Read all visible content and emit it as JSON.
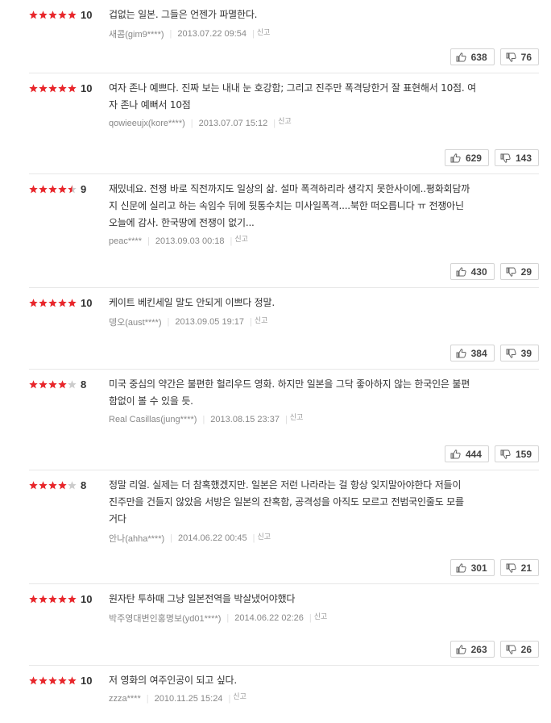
{
  "colors": {
    "star_on": "#e8262b",
    "star_off": "#cccccc",
    "text": "#333333",
    "meta": "#999999"
  },
  "report_label": "신고",
  "reviews": [
    {
      "stars": 5,
      "half": false,
      "score": "10",
      "lines": [
        "겁없는 일본. 그들은 언젠가 파멸한다."
      ],
      "author": "새콤(gim9****)",
      "date": "2013.07.22 09:54",
      "up": "638",
      "down": "76"
    },
    {
      "stars": 5,
      "half": false,
      "score": "10",
      "lines": [
        "여자 존나 예쁘다. 진짜 보는 내내 눈 호강함; 그리고 진주만 폭격당한거 잘 표현해서 10점. 여",
        "자 존나 예뻐서 10점"
      ],
      "author": "qowieeujx(kore****)",
      "date": "2013.07.07 15:12",
      "up": "629",
      "down": "143"
    },
    {
      "stars": 4,
      "half": true,
      "score": "9",
      "lines": [
        "재밌네요. 전쟁 바로 직전까지도 일상의 삶. 설마 폭격하리라 생각지 못한사이에..평화회담까",
        "지 신문에 실리고 하는 속임수 뒤에 뒷통수치는 미사일폭격....북한 떠오릅니다 ㅠ 전쟁아닌",
        "오늘에 감사. 한국땅에 전쟁이 없기..."
      ],
      "author": "peac****",
      "date": "2013.09.03 00:18",
      "up": "430",
      "down": "29"
    },
    {
      "stars": 5,
      "half": false,
      "score": "10",
      "lines": [
        "케이트 베킨세일 말도 안되게 이쁘다 정말."
      ],
      "author": "뎅오(aust****)",
      "date": "2013.09.05 19:17",
      "up": "384",
      "down": "39"
    },
    {
      "stars": 4,
      "half": false,
      "score": "8",
      "lines": [
        "미국 중심의 약간은 불편한 헐리우드 영화. 하지만 일본을 그닥 좋아하지 않는 한국인은 불편",
        "함없이 볼 수 있을 듯."
      ],
      "author": "Real Casillas(jung****)",
      "date": "2013.08.15 23:37",
      "up": "444",
      "down": "159"
    },
    {
      "stars": 4,
      "half": false,
      "score": "8",
      "lines": [
        "정말 리얼. 실제는 더 참혹했겠지만. 일본은 저런 나라라는 걸 항상 잊지말아야한다 저들이",
        "진주만을 건들지 않았음 서방은 일본의 잔혹함, 공격성을 아직도 모르고 전범국인줄도 모를",
        "거다"
      ],
      "author": "안나(ahha****)",
      "date": "2014.06.22 00:45",
      "up": "301",
      "down": "21"
    },
    {
      "stars": 5,
      "half": false,
      "score": "10",
      "lines": [
        "원자탄 투하때 그냥 일본전역을 박살냈어야했다"
      ],
      "author": "박주영대변인홍명보(yd01****)",
      "date": "2014.06.22 02:26",
      "up": "263",
      "down": "26"
    },
    {
      "stars": 5,
      "half": false,
      "score": "10",
      "lines": [
        "저 영화의 여주인공이 되고 싶다."
      ],
      "author": "zzza****",
      "date": "2010.11.25 15:24",
      "up": "",
      "down": ""
    }
  ]
}
